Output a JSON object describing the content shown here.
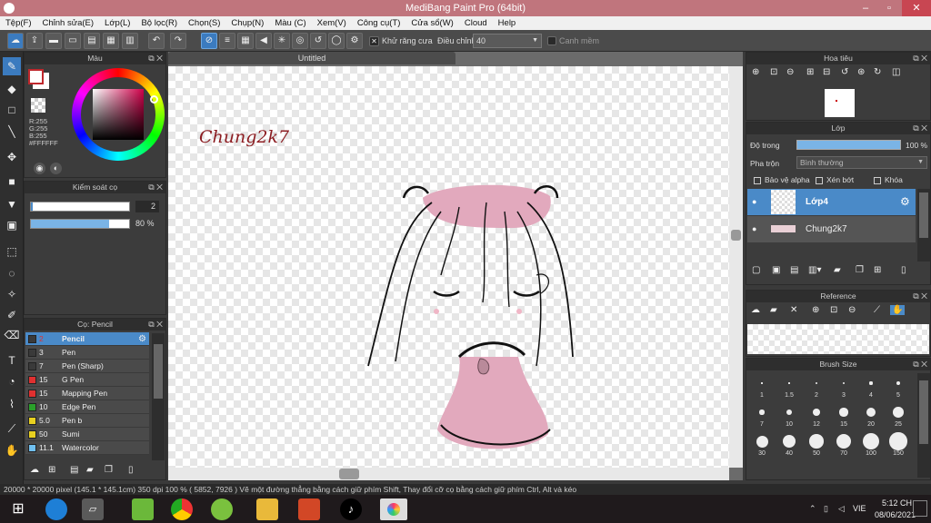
{
  "titlebar": {
    "title": "MediBang Paint Pro (64bit)",
    "min": "–",
    "max": "▫",
    "close": "✕"
  },
  "menu": [
    "Tệp(F)",
    "Chỉnh sửa(E)",
    "Lớp(L)",
    "Bộ lọc(R)",
    "Chọn(S)",
    "Chụp(N)",
    "Màu (C)",
    "Xem(V)",
    "Công cụ(T)",
    "Cửa sổ(W)",
    "Cloud",
    "Help"
  ],
  "toolbar": {
    "antialias_label": "Khử răng cưa",
    "adjust_label": "Điều chỉnh",
    "adjust_value": "40",
    "snap_label": "Canh mềm"
  },
  "document": {
    "tab": "Untitled",
    "signature": "Chung2k7"
  },
  "color_panel": {
    "title": "Màu",
    "r": "R:255",
    "g": "G:255",
    "b": "B:255",
    "hex": "#FFFFFF",
    "primary": "#c0282d"
  },
  "brush_control": {
    "title": "Kiểm soát cọ",
    "size": "2",
    "opacity": "80 %",
    "opacity_fraction": 0.8
  },
  "brush_panel": {
    "title": "Cọ: Pencil",
    "items": [
      {
        "color": "#3a3a3a",
        "size": "2",
        "name": "Pencil"
      },
      {
        "color": "#3a3a3a",
        "size": "3",
        "name": "Pen"
      },
      {
        "color": "#3a3a3a",
        "size": "7",
        "name": "Pen (Sharp)"
      },
      {
        "color": "#e03030",
        "size": "15",
        "name": "G Pen"
      },
      {
        "color": "#e03030",
        "size": "15",
        "name": "Mapping Pen"
      },
      {
        "color": "#2aa02a",
        "size": "10",
        "name": "Edge Pen"
      },
      {
        "color": "#e8d020",
        "size": "5.0",
        "name": "Pen b"
      },
      {
        "color": "#e8d020",
        "size": "50",
        "name": "Sumi"
      },
      {
        "color": "#70c0f0",
        "size": "11.1",
        "name": "Watercolor"
      }
    ]
  },
  "navigator": {
    "title": "Hoa tiêu"
  },
  "layer_panel": {
    "title": "Lớp",
    "opacity_label": "Độ trong",
    "opacity_value": "100 %",
    "blend_label": "Pha trộn",
    "blend_value": "Bình thường",
    "alpha_label": "Bảo vệ alpha",
    "clip_label": "Xén bớt",
    "lock_label": "Khóa",
    "layers": [
      {
        "name": "Lớp4"
      },
      {
        "name": "Chung2k7"
      }
    ]
  },
  "reference": {
    "title": "Reference"
  },
  "brush_size": {
    "title": "Brush Size",
    "sizes": [
      "1",
      "1.5",
      "2",
      "3",
      "4",
      "5",
      "7",
      "10",
      "12",
      "15",
      "20",
      "25",
      "30",
      "40",
      "50",
      "70",
      "100",
      "150"
    ]
  },
  "status": "20000 * 20000 pixel   (145.1 * 145.1cm)   350 dpi   100 %   ( 5852, 7926 )   Vẽ một đường thẳng bằng cách giữ phím Shift, Thay đổi cỡ cọ bằng cách giữ phím Ctrl, Alt và kéo",
  "taskbar": {
    "lang": "VIE",
    "time": "5:12 CH",
    "date": "08/06/2021"
  }
}
